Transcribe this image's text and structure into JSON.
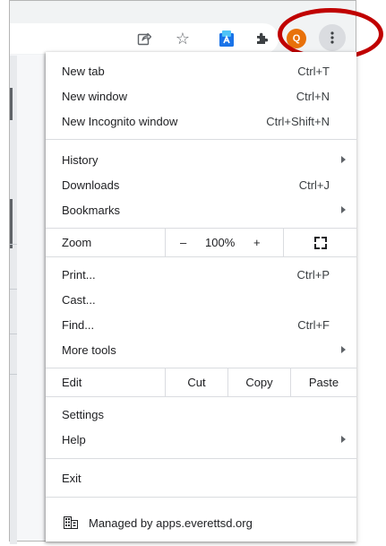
{
  "toolbar": {
    "icons": [
      "share-icon",
      "star-icon",
      "extension-icon",
      "puzzle-icon",
      "kebab-menu-icon"
    ],
    "avatar_letter": "Q",
    "accent_color": "#e8710a",
    "highlight_color": "#c00000"
  },
  "menu": {
    "new_tab": {
      "label": "New tab",
      "shortcut": "Ctrl+T"
    },
    "new_window": {
      "label": "New window",
      "shortcut": "Ctrl+N"
    },
    "new_incognito": {
      "label": "New Incognito window",
      "shortcut": "Ctrl+Shift+N"
    },
    "history": {
      "label": "History"
    },
    "downloads": {
      "label": "Downloads",
      "shortcut": "Ctrl+J"
    },
    "bookmarks": {
      "label": "Bookmarks"
    },
    "zoom": {
      "label": "Zoom",
      "minus": "–",
      "level": "100%",
      "plus": "+"
    },
    "print": {
      "label": "Print...",
      "shortcut": "Ctrl+P"
    },
    "cast": {
      "label": "Cast..."
    },
    "find": {
      "label": "Find...",
      "shortcut": "Ctrl+F"
    },
    "more_tools": {
      "label": "More tools"
    },
    "edit": {
      "label": "Edit",
      "cut": "Cut",
      "copy": "Copy",
      "paste": "Paste"
    },
    "settings": {
      "label": "Settings"
    },
    "help": {
      "label": "Help"
    },
    "exit": {
      "label": "Exit"
    },
    "managed": {
      "label": "Managed by apps.everettsd.org"
    }
  }
}
